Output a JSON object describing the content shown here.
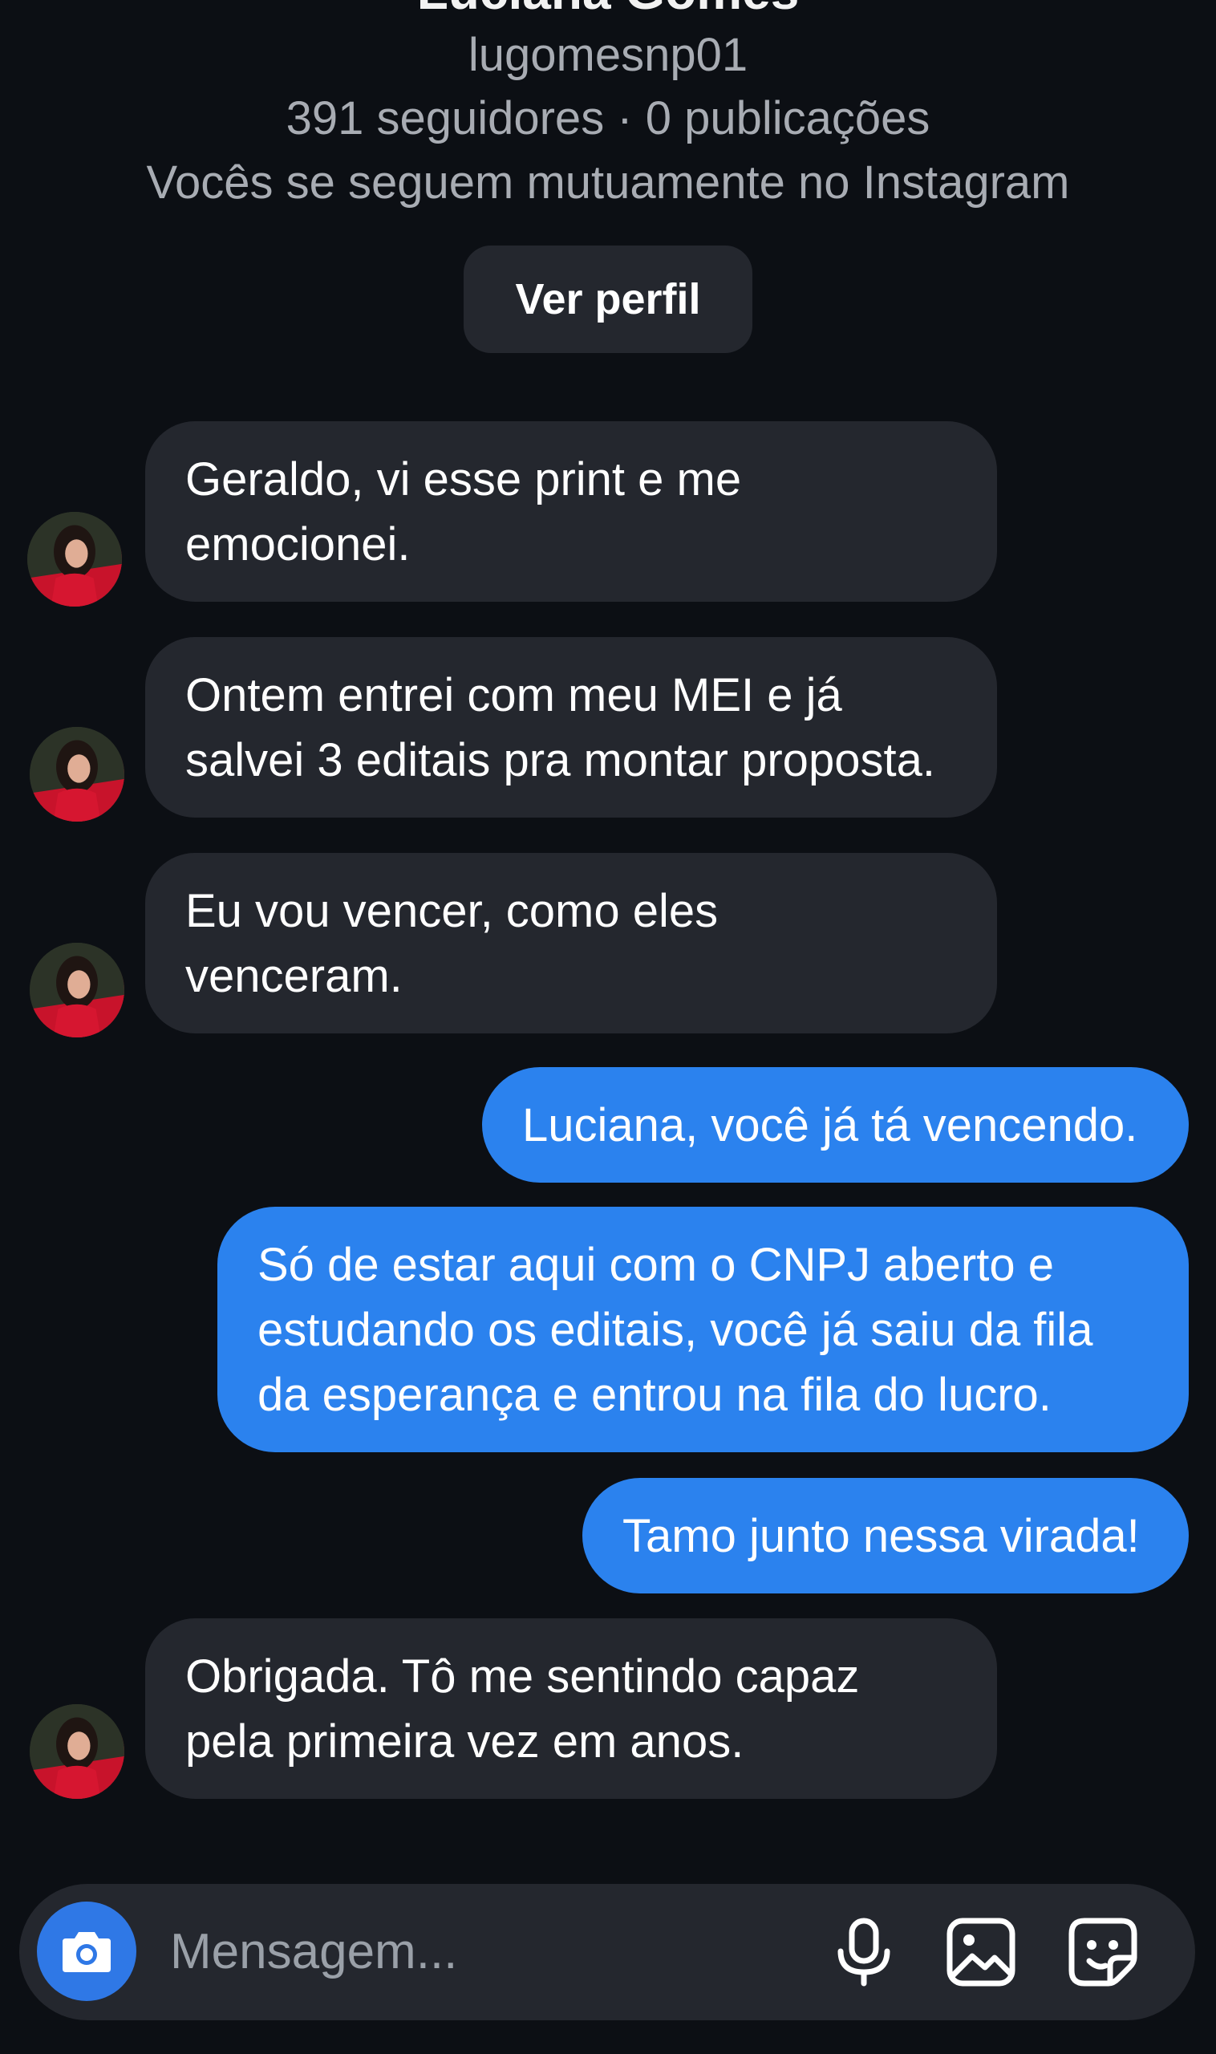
{
  "profile": {
    "name": "Luciana Gomes",
    "username": "lugomesnp01",
    "stats": "391 seguidores · 0 publicações",
    "mutual_note": "Vocês se seguem mutuamente no Instagram",
    "view_profile_label": "Ver perfil"
  },
  "messages": [
    {
      "direction": "incoming",
      "lines": [
        "Geraldo, vi esse print e me",
        "emocionei."
      ]
    },
    {
      "direction": "incoming",
      "lines": [
        "Ontem entrei com meu MEI e já",
        "salvei 3 editais pra montar proposta."
      ]
    },
    {
      "direction": "incoming",
      "lines": [
        "Eu vou vencer, como eles",
        "venceram."
      ]
    },
    {
      "direction": "outgoing",
      "lines": [
        "Luciana, você já tá vencendo."
      ]
    },
    {
      "direction": "outgoing",
      "lines": [
        "Só de estar aqui com o CNPJ aberto e",
        "estudando os editais, você já saiu da fila",
        "da esperança e entrou na fila do lucro."
      ]
    },
    {
      "direction": "outgoing",
      "lines": [
        "Tamo junto nessa virada!"
      ]
    },
    {
      "direction": "incoming",
      "lines": [
        "Obrigada. Tô me sentindo capaz",
        "pela primeira vez em anos."
      ]
    }
  ],
  "composer": {
    "placeholder": "Mensagem...",
    "icons": [
      "camera-icon",
      "microphone-icon",
      "gallery-icon",
      "sticker-icon"
    ]
  },
  "colors": {
    "background": "#0c0f14",
    "incoming_bubble": "#24272e",
    "outgoing_bubble": "#2b82ee",
    "camera_button": "#2f78e6"
  }
}
